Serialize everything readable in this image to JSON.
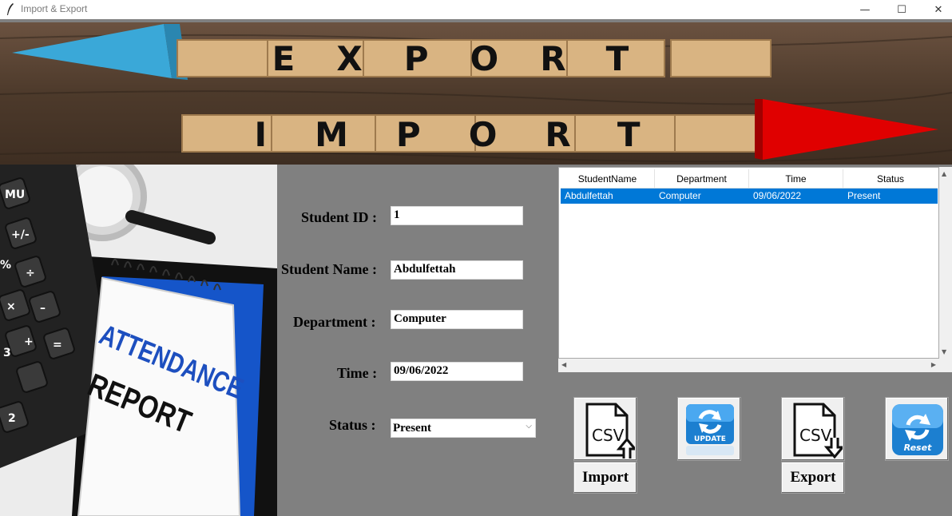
{
  "window": {
    "title": "Import & Export",
    "minimize_glyph": "—",
    "maximize_glyph": "☐",
    "close_glyph": "✕"
  },
  "banner": {
    "top_word": "EXPORT",
    "bottom_word": "IMPORT",
    "colors": {
      "left_arrow": "#3aa8d8",
      "right_arrow": "#e00000",
      "wood": "#5a4330",
      "tile": "#d9b482"
    }
  },
  "photo": {
    "line1": "ATTENDANCE",
    "line2": "REPORT",
    "calc_keys": [
      "MU",
      "+/-",
      "%",
      "÷",
      "×",
      "–",
      "+",
      "=",
      "3",
      "2"
    ]
  },
  "form": {
    "student_id_label": "Student ID :",
    "student_id_value": "1",
    "student_name_label": "Student Name :",
    "student_name_value": "Abdulfettah",
    "department_label": "Department :",
    "department_value": "Computer",
    "time_label": "Time :",
    "time_value": "09/06/2022",
    "status_label": "Status :",
    "status_value": "Present"
  },
  "table": {
    "columns": [
      "StudentName",
      "Department",
      "Time",
      "Status"
    ],
    "rows": [
      [
        "Abdulfettah",
        "Computer",
        "09/06/2022",
        "Present"
      ]
    ]
  },
  "buttons": {
    "import_label": "Import",
    "export_label": "Export",
    "csv_text": "CSV",
    "update_text": "UPDATE",
    "reset_text": "Reset",
    "icons": [
      "csv-import-icon",
      "update-icon",
      "csv-export-icon",
      "reset-icon"
    ]
  },
  "colors": {
    "background": "#808080",
    "selection": "#0078d7"
  }
}
